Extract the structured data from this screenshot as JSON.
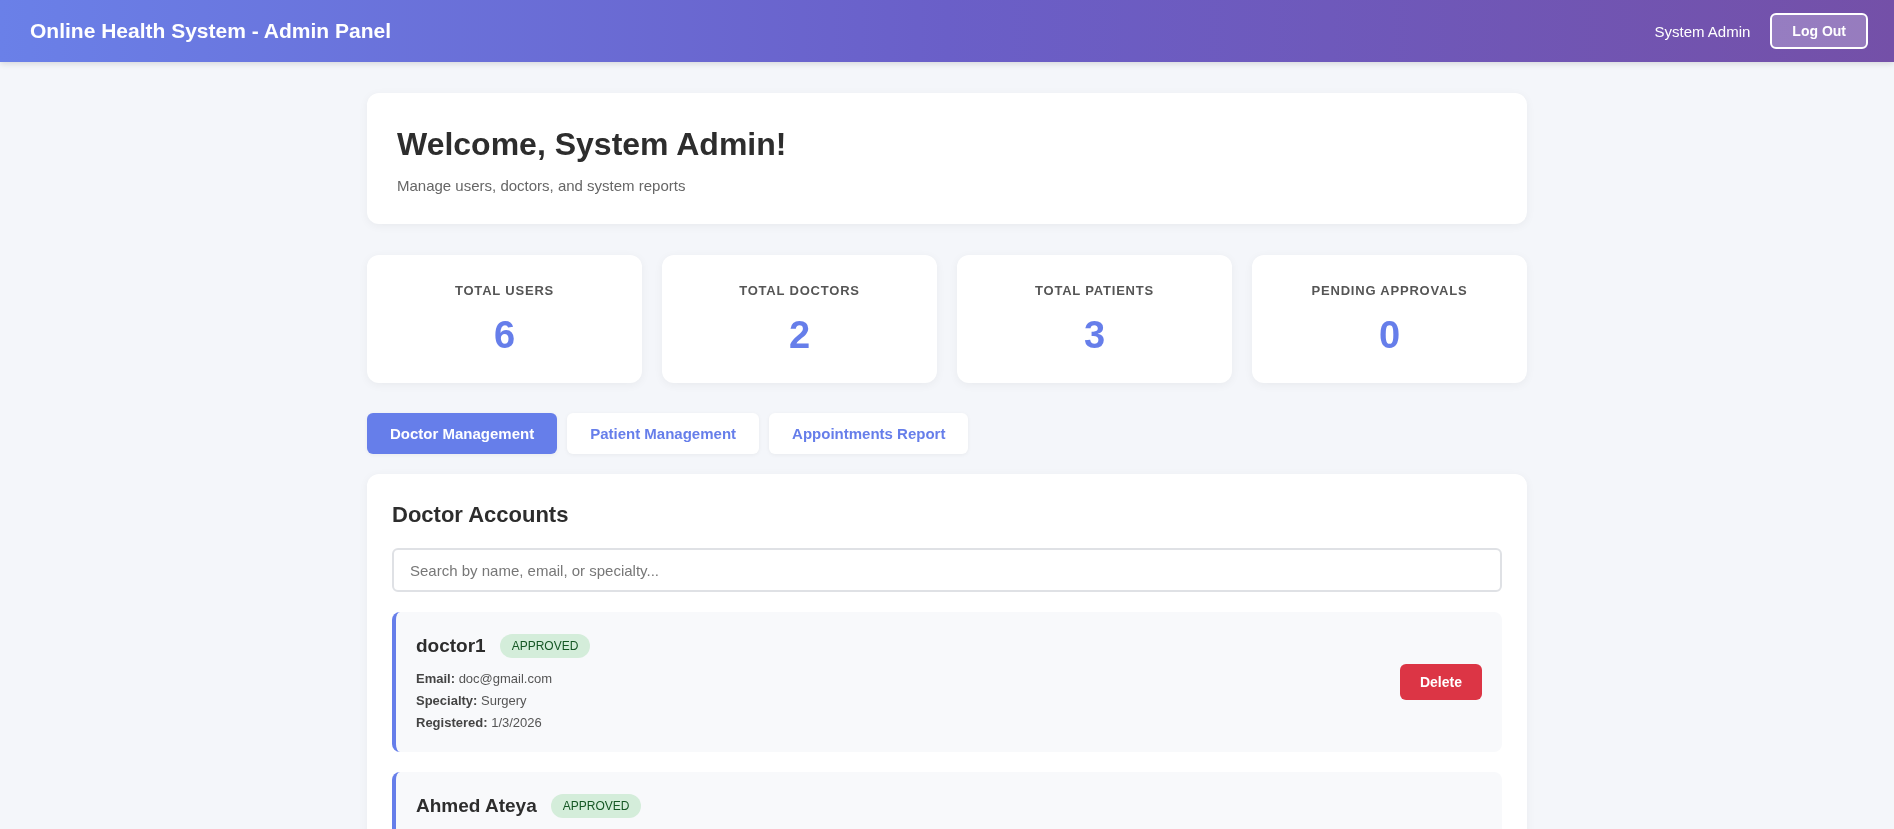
{
  "header": {
    "title": "Online Health System - Admin Panel",
    "user": "System Admin",
    "logout": "Log Out"
  },
  "welcome": {
    "title": "Welcome, System Admin!",
    "subtitle": "Manage users, doctors, and system reports"
  },
  "stats": [
    {
      "label": "TOTAL USERS",
      "value": "6"
    },
    {
      "label": "TOTAL DOCTORS",
      "value": "2"
    },
    {
      "label": "TOTAL PATIENTS",
      "value": "3"
    },
    {
      "label": "PENDING APPROVALS",
      "value": "0"
    }
  ],
  "tabs": [
    {
      "label": "Doctor Management",
      "selected": true
    },
    {
      "label": "Patient Management",
      "selected": false
    },
    {
      "label": "Appointments Report",
      "selected": false
    }
  ],
  "panel": {
    "title": "Doctor Accounts",
    "search": {
      "placeholder": "Search by name, email, or specialty..."
    },
    "doctors": [
      {
        "name": "doctor1",
        "status": {
          "kind": "approved",
          "label": "APPROVED"
        },
        "fields": [
          {
            "label": "Email:",
            "value": "doc@gmail.com"
          },
          {
            "label": "Specialty:",
            "value": "Surgery"
          },
          {
            "label": "Registered:",
            "value": "1/3/2026"
          }
        ],
        "action": "Delete"
      },
      {
        "name": "Ahmed Ateya",
        "status": {
          "kind": "approved",
          "label": "APPROVED"
        }
      }
    ]
  }
}
